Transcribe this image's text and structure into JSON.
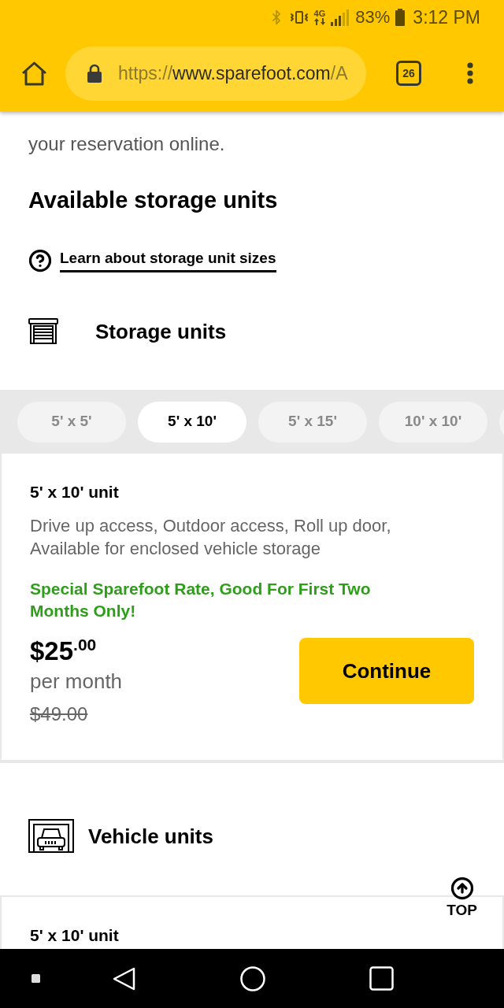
{
  "status_bar": {
    "network_type": "4G",
    "battery": "83%",
    "time": "3:12 PM"
  },
  "browser": {
    "url": {
      "scheme": "https://",
      "host": "www.sparefoot.com",
      "path": "/A"
    },
    "tab_count": "26"
  },
  "intro": "your reservation online.",
  "heading": "Available storage units",
  "help_link": "Learn about storage unit sizes",
  "sections": [
    {
      "kind": "storage",
      "title": "Storage units",
      "size_tabs": [
        {
          "label": "5' x 5'",
          "selected": false
        },
        {
          "label": "5' x 10'",
          "selected": true
        },
        {
          "label": "5' x 15'",
          "selected": false
        },
        {
          "label": "10' x 10'",
          "selected": false
        }
      ],
      "units": [
        {
          "title": "5' x 10' unit",
          "features": "Drive up access, Outdoor access, Roll up door, Available for enclosed vehicle storage",
          "promo": "Special Sparefoot Rate, Good For First Two Months Only!",
          "price": "$25$^{.00}$",
          "period": "per month",
          "original_price": "$49.00",
          "action": "Continue"
        }
      ]
    },
    {
      "kind": "vehicle",
      "title": "Vehicle units",
      "units": [
        {
          "title": "5' x 10' unit"
        }
      ]
    }
  ],
  "top_button": "TOP"
}
